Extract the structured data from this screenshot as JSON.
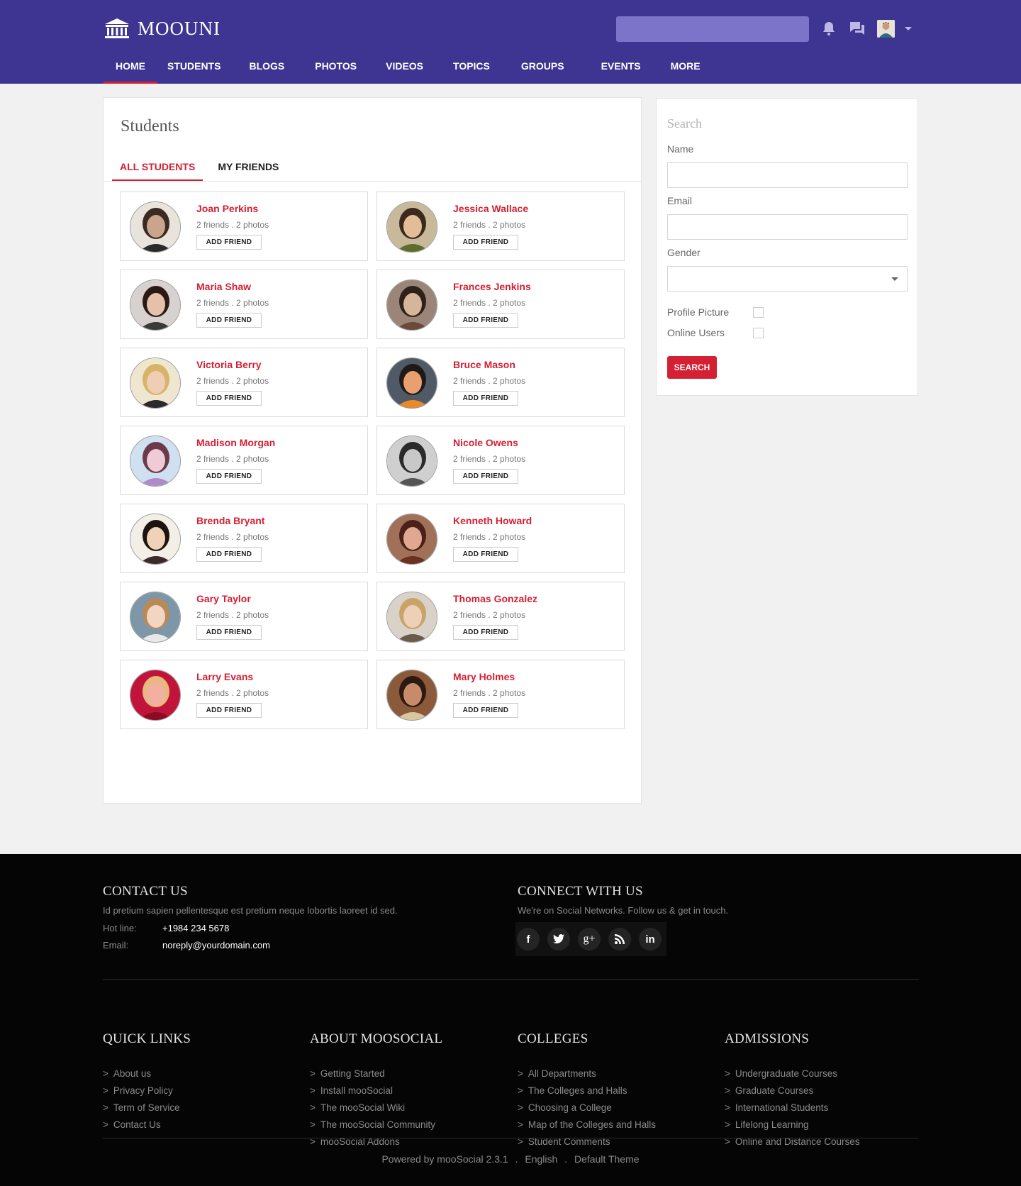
{
  "header": {
    "brand": "MOOUNI",
    "search_placeholder": "",
    "nav": [
      "HOME",
      "STUDENTS",
      "BLOGS",
      "PHOTOS",
      "VIDEOS",
      "TOPICS",
      "GROUPS",
      "EVENTS",
      "MORE"
    ],
    "accent_color": "#3d3591"
  },
  "main": {
    "title": "Students",
    "tabs": [
      "ALL STUDENTS",
      "MY FRIENDS"
    ],
    "add_friend_label": "ADD FRIEND",
    "students": [
      {
        "name": "Joan Perkins",
        "meta": "2 friends . 2 photos"
      },
      {
        "name": "Jessica Wallace",
        "meta": "2 friends . 2 photos"
      },
      {
        "name": "Maria Shaw",
        "meta": "2 friends . 2 photos"
      },
      {
        "name": "Frances Jenkins",
        "meta": "2 friends . 2 photos"
      },
      {
        "name": "Victoria Berry",
        "meta": "2 friends . 2 photos"
      },
      {
        "name": "Bruce Mason",
        "meta": "2 friends . 2 photos"
      },
      {
        "name": "Madison Morgan",
        "meta": "2 friends . 2 photos"
      },
      {
        "name": "Nicole Owens",
        "meta": "2 friends . 2 photos"
      },
      {
        "name": "Brenda Bryant",
        "meta": "2 friends . 2 photos"
      },
      {
        "name": "Kenneth Howard",
        "meta": "2 friends . 2 photos"
      },
      {
        "name": "Gary Taylor",
        "meta": "2 friends . 2 photos"
      },
      {
        "name": "Thomas Gonzalez",
        "meta": "2 friends . 2 photos"
      },
      {
        "name": "Larry Evans",
        "meta": "2 friends . 2 photos"
      },
      {
        "name": "Mary Holmes",
        "meta": "2 friends . 2 photos"
      }
    ]
  },
  "sidebar": {
    "title": "Search",
    "name_label": "Name",
    "email_label": "Email",
    "gender_label": "Gender",
    "profile_picture_label": "Profile Picture",
    "online_users_label": "Online Users",
    "search_button": "SEARCH"
  },
  "footer": {
    "contact": {
      "heading": "CONTACT US",
      "text": "Id pretium sapien pellentesque est pretium neque lobortis laoreet id sed.",
      "hotline_label": "Hot line:",
      "hotline": "+1984 234 5678",
      "email_label": "Email:",
      "email": "noreply@yourdomain.com"
    },
    "connect": {
      "heading": "CONNECT WITH US",
      "text": "We're on Social Networks. Follow us & get in touch.",
      "icons": [
        "facebook-icon",
        "twitter-icon",
        "google-plus-icon",
        "rss-icon",
        "linkedin-icon"
      ]
    },
    "columns": [
      {
        "heading": "QUICK LINKS",
        "links": [
          "About us",
          "Privacy Policy",
          "Term of Service",
          "Contact Us"
        ]
      },
      {
        "heading": "ABOUT MOOSOCIAL",
        "links": [
          "Getting Started",
          "Install mooSocial",
          "The mooSocial Wiki",
          "The mooSocial Community",
          "mooSocial Addons"
        ]
      },
      {
        "heading": "COLLEGES",
        "links": [
          "All Departments",
          "The Colleges and Halls",
          "Choosing a College",
          "Map of the Colleges and Halls",
          "Student Comments"
        ]
      },
      {
        "heading": "ADMISSIONS",
        "links": [
          "Undergraduate Courses",
          "Graduate Courses",
          "International Students",
          "Lifelong Learning",
          "Online and Distance Courses"
        ]
      }
    ],
    "powered": "Powered by mooSocial 2.3.1",
    "language": "English",
    "theme": "Default Theme",
    "separator": "."
  }
}
